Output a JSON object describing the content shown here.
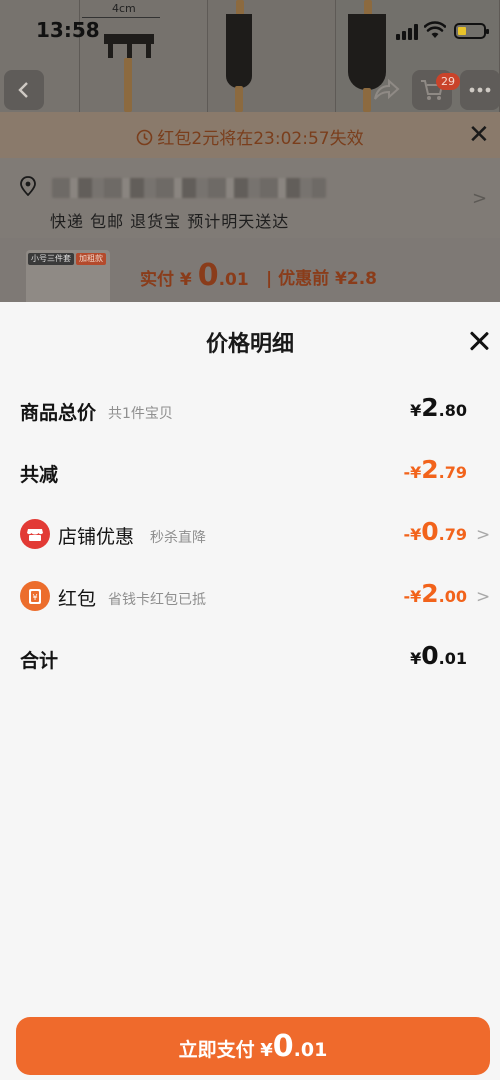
{
  "status_bar": {
    "time": "13:58"
  },
  "background": {
    "size_label": "4cm",
    "cart_badge": "29",
    "coupon_notice": "红包2元将在23:02:57失效",
    "shipping": "快递 包邮 退货宝 预计明天送达",
    "product_tags": [
      "小号三件套",
      "加粗款"
    ],
    "actual_pay": {
      "label": "实付",
      "currency": "¥",
      "integer": "0",
      "decimal": ".01"
    },
    "before_discount": "| 优惠前 ¥2.8"
  },
  "sheet": {
    "title": "价格明细",
    "rows": [
      {
        "label": "商品总价",
        "sub": "共1件宝贝",
        "currency": "¥",
        "integer": "2",
        "decimal": ".80"
      },
      {
        "label": "共减",
        "sub": "",
        "currency": "-¥",
        "integer": "2",
        "decimal": ".79"
      },
      {
        "label": "店铺优惠",
        "sub": "秒杀直降",
        "currency": "-¥",
        "integer": "0",
        "decimal": ".79"
      },
      {
        "label": "红包",
        "sub": "省钱卡红包已抵",
        "currency": "-¥",
        "integer": "2",
        "decimal": ".00"
      },
      {
        "label": "合计",
        "sub": "",
        "currency": "¥",
        "integer": "0",
        "decimal": ".01"
      }
    ],
    "pay_button": {
      "label": "立即支付",
      "currency": "¥",
      "integer": "0",
      "decimal": ".01"
    }
  },
  "colors": {
    "accent": "#f2631b",
    "pay_button": "#ef6a2c",
    "shop_icon": "#e23a35",
    "redpacket_icon": "#ec6d2c"
  },
  "icons": [
    "back-arrow-icon",
    "share-icon",
    "cart-icon",
    "more-icon",
    "clock-icon",
    "close-icon",
    "location-pin-icon",
    "chevron-right-icon",
    "shop-icon",
    "red-packet-icon"
  ]
}
